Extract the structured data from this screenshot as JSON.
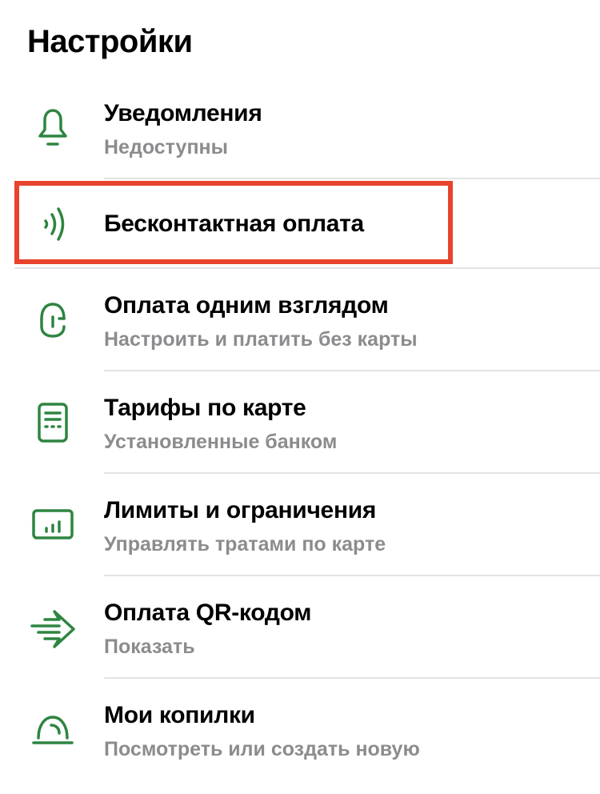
{
  "header": {
    "title": "Настройки"
  },
  "colors": {
    "accent": "#2e8540",
    "highlight": "#e8432d",
    "subtitle": "#8c8c8f",
    "divider": "#e3e3e5"
  },
  "items": [
    {
      "icon": "bell-icon",
      "title": "Уведомления",
      "subtitle": "Недоступны"
    },
    {
      "icon": "contactless-icon",
      "title": "Бесконтактная оплата",
      "subtitle": ""
    },
    {
      "icon": "face-id-icon",
      "title": "Оплата одним взглядом",
      "subtitle": "Настроить и платить без карты"
    },
    {
      "icon": "tariff-document-icon",
      "title": "Тарифы по карте",
      "subtitle": "Установленные банком"
    },
    {
      "icon": "limits-chart-icon",
      "title": "Лимиты и ограничения",
      "subtitle": "Управлять тратами по карте"
    },
    {
      "icon": "qr-payment-arrow-icon",
      "title": "Оплата QR-кодом",
      "subtitle": "Показать"
    },
    {
      "icon": "piggy-bank-icon",
      "title": "Мои копилки",
      "subtitle": "Посмотреть или создать новую"
    }
  ]
}
